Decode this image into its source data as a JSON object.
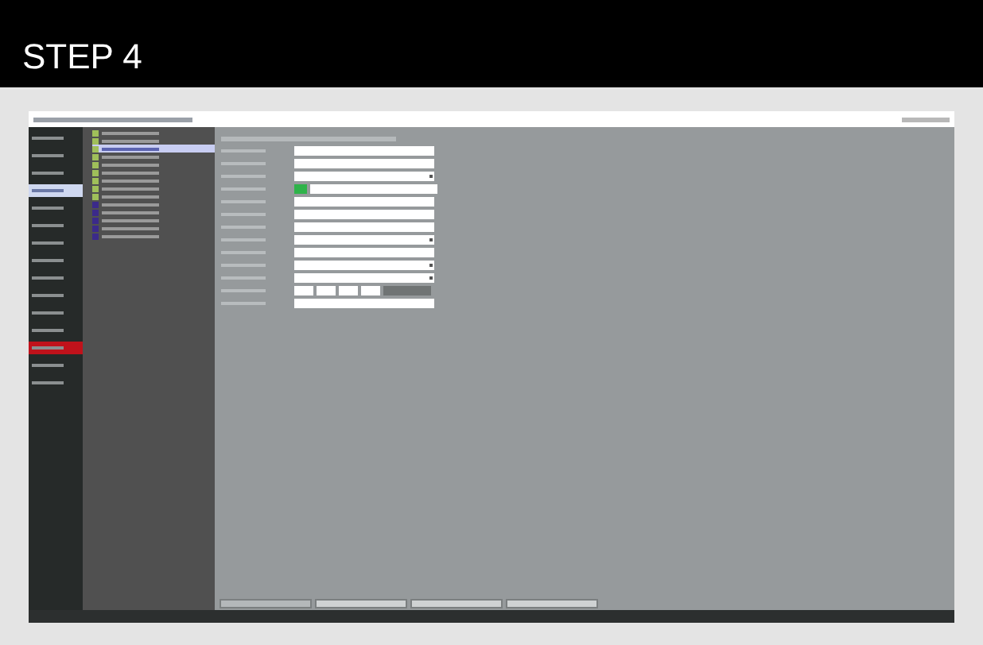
{
  "title": "STEP 4",
  "app": {
    "sidebar": [
      {
        "selected": false
      },
      {
        "selected": false
      },
      {
        "selected": false
      },
      {
        "selected": true
      },
      {
        "selected": false
      },
      {
        "selected": false
      },
      {
        "selected": false
      },
      {
        "selected": false
      },
      {
        "selected": false
      },
      {
        "selected": false
      },
      {
        "selected": false
      },
      {
        "selected": false
      },
      {
        "selected": false,
        "color": "#c0121b"
      },
      {
        "selected": false
      },
      {
        "selected": false
      }
    ],
    "tree": [
      {
        "selected": false
      },
      {
        "selected": false
      },
      {
        "selected": true
      },
      {
        "selected": false
      },
      {
        "selected": false
      },
      {
        "selected": false
      },
      {
        "selected": false
      },
      {
        "selected": false
      },
      {
        "selected": false
      },
      {
        "selected": false
      },
      {
        "selected": false
      },
      {
        "selected": false
      },
      {
        "selected": false
      },
      {
        "selected": false
      }
    ],
    "form": [
      {
        "kind": "field"
      },
      {
        "kind": "field"
      },
      {
        "kind": "select"
      },
      {
        "kind": "color",
        "color": "#2fb34a"
      },
      {
        "kind": "field"
      },
      {
        "kind": "field"
      },
      {
        "kind": "field"
      },
      {
        "kind": "select"
      },
      {
        "kind": "field"
      },
      {
        "kind": "select"
      },
      {
        "kind": "select"
      },
      {
        "kind": "time"
      },
      {
        "kind": "field"
      }
    ],
    "buttons": [
      {
        "disabled": true
      },
      {
        "disabled": false
      },
      {
        "disabled": false
      },
      {
        "disabled": false
      }
    ]
  }
}
